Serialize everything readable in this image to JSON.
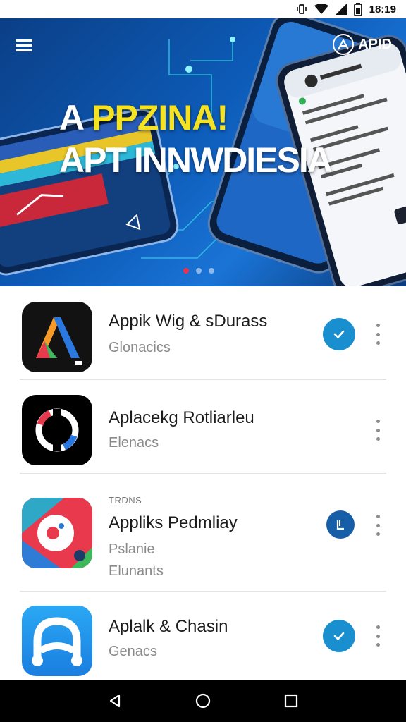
{
  "status_bar": {
    "time": "18:19",
    "icons": [
      "vibrate-icon",
      "wifi-icon",
      "signal-icon",
      "battery-icon"
    ]
  },
  "hero": {
    "title_line1_prefix": "A ",
    "title_line1_main": "PPZINA!",
    "title_line2": "APT INNWDIESIA",
    "brand": "APID",
    "carousel": {
      "count": 3,
      "active": 1
    }
  },
  "apps": [
    {
      "name": "Appik Wig & sDurass",
      "subtitle": "Glonacics",
      "tag": "",
      "extra": "",
      "action": "check"
    },
    {
      "name": "Aplacekg Rotliarleu",
      "subtitle": "Elenacs",
      "tag": "",
      "extra": "",
      "action": "none"
    },
    {
      "name": "Appliks Pedmliay",
      "subtitle": "Pslanie",
      "tag": "TRDNS",
      "extra": "Elunants",
      "action": "update"
    },
    {
      "name": "Aplalk & Chasin",
      "subtitle": "Genacs",
      "tag": "",
      "extra": "",
      "action": "check"
    }
  ],
  "colors": {
    "accent": "#1a8fd0",
    "hero_bg": "#0d5bb8",
    "title_yellow": "#f5e223",
    "indicator_active": "#e8334a"
  },
  "nav": [
    "back-icon",
    "home-icon",
    "recents-icon"
  ]
}
